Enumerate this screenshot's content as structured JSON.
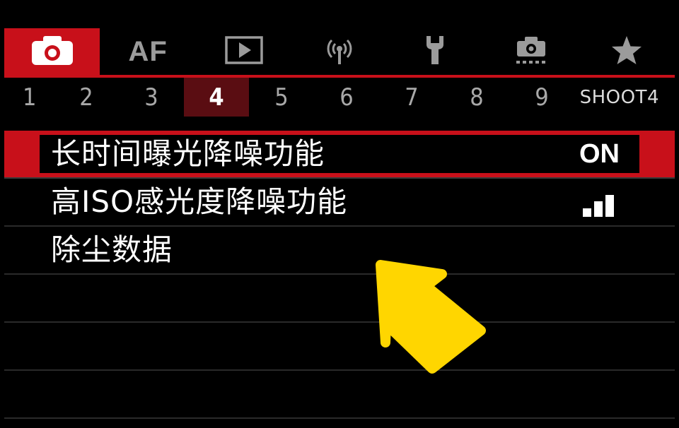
{
  "menu_tabs": [
    {
      "name": "shooting",
      "icon": "camera-icon",
      "active": true
    },
    {
      "name": "af",
      "label": "AF",
      "active": false
    },
    {
      "name": "playback",
      "icon": "playback-icon",
      "active": false
    },
    {
      "name": "wireless",
      "icon": "wireless-icon",
      "active": false
    },
    {
      "name": "setup",
      "icon": "wrench-icon",
      "active": false
    },
    {
      "name": "custom",
      "icon": "custom-camera-icon",
      "active": false
    },
    {
      "name": "my-menu",
      "icon": "star-icon",
      "active": false
    }
  ],
  "page_tabs": [
    "1",
    "2",
    "3",
    "4",
    "5",
    "6",
    "7",
    "8",
    "9"
  ],
  "active_page": "4",
  "page_name": "SHOOT4",
  "items": [
    {
      "label": "长时间曝光降噪功能",
      "value": "ON",
      "selected": true
    },
    {
      "label": "高ISO感光度降噪功能",
      "value_icon": "level-bars-icon",
      "level": 3,
      "level_max": 4
    },
    {
      "label": "除尘数据"
    },
    {
      "label": ""
    },
    {
      "label": ""
    },
    {
      "label": ""
    }
  ],
  "colors": {
    "accent": "#c8101a",
    "active_page_bg": "#5a0d12",
    "arrow": "#ffd600",
    "background": "#000000"
  }
}
